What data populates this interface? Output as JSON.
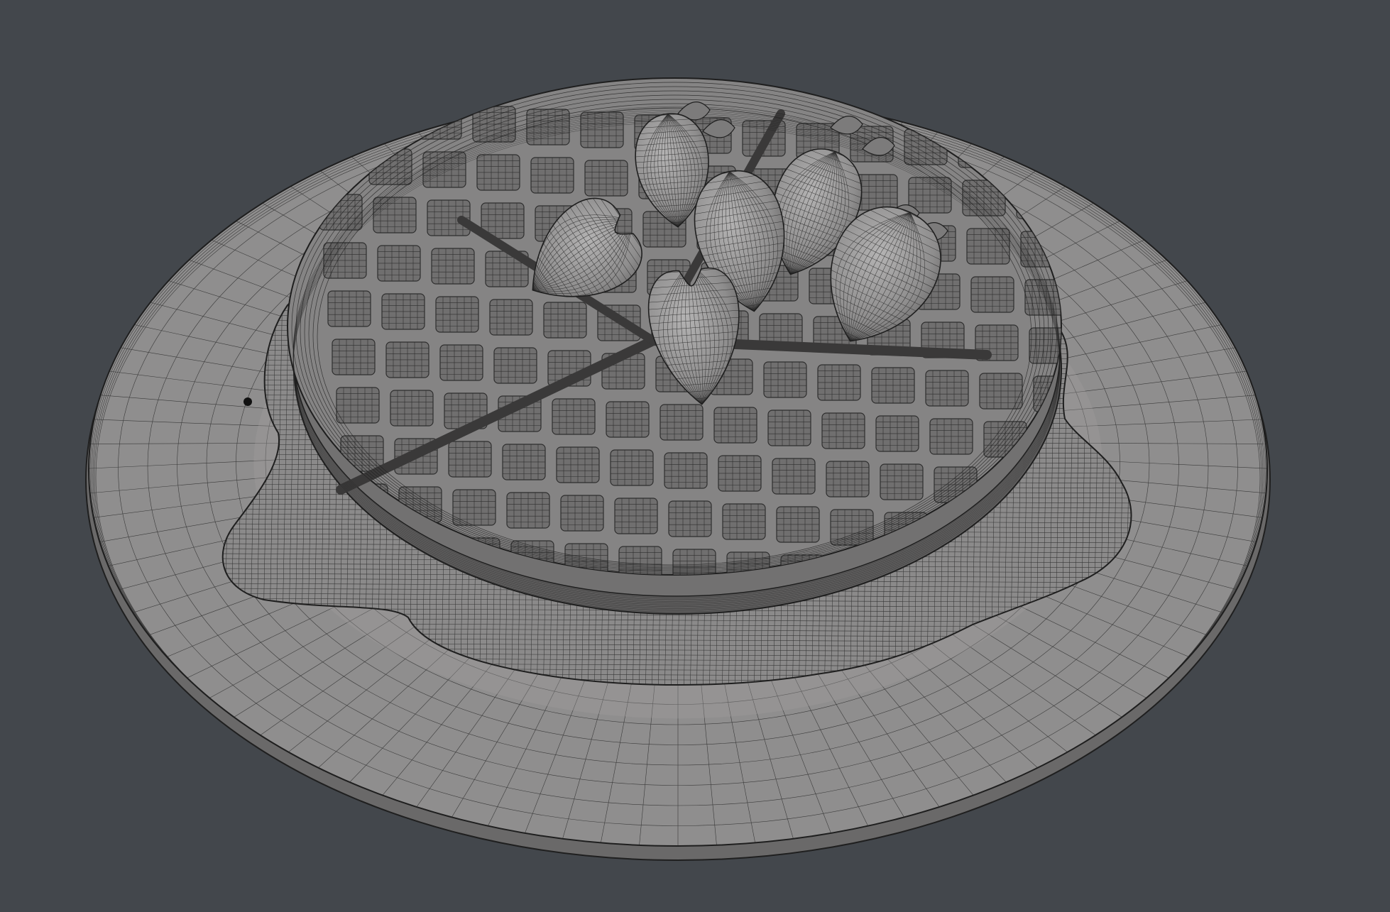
{
  "viewport": {
    "background_color": "#43474c",
    "shading": "solid",
    "overlay": "wireframe"
  },
  "materials": {
    "plate_rim_color": "#8f8e8e",
    "plate_top_color": "#a09f9f",
    "plate_edge_color": "#6a6969",
    "syrup_color": "#8b8a8a",
    "waffle_color": "#858484",
    "waffle_dark_color": "#5e5d5d",
    "strawberry_color": "#9a9999",
    "strawberry_slice_color": "#8e8d8d",
    "wire_color": "#1f1f1f"
  },
  "scene_objects": [
    {
      "name": "plate",
      "icon": "plate-icon"
    },
    {
      "name": "syrup-puddle",
      "icon": "liquid-icon"
    },
    {
      "name": "waffle",
      "icon": "waffle-icon",
      "quarters": 4
    },
    {
      "name": "strawberries",
      "icon": "strawberry-icon",
      "whole": 3,
      "halves": 3
    }
  ]
}
